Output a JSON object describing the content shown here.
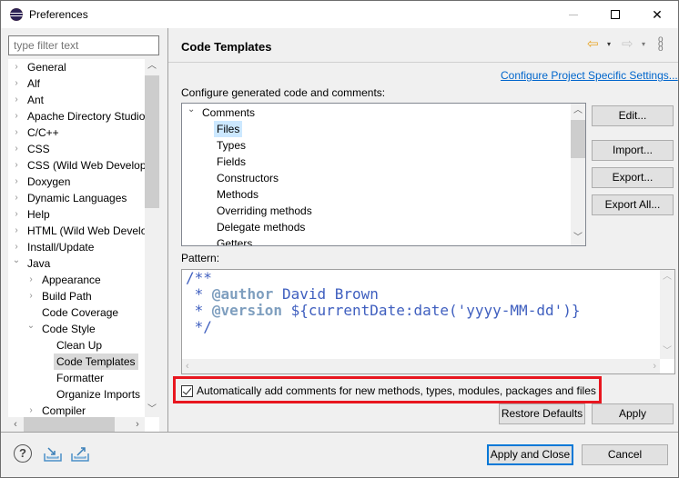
{
  "window": {
    "title": "Preferences",
    "controls": {
      "minimize": "—",
      "maximize": "□",
      "close": "✕"
    }
  },
  "sidebar": {
    "filter_placeholder": "type filter text",
    "items": [
      {
        "label": "General",
        "level": 0,
        "expander": "collapsed"
      },
      {
        "label": "Alf",
        "level": 0,
        "expander": "collapsed"
      },
      {
        "label": "Ant",
        "level": 0,
        "expander": "collapsed"
      },
      {
        "label": "Apache Directory Studio",
        "level": 0,
        "expander": "collapsed"
      },
      {
        "label": "C/C++",
        "level": 0,
        "expander": "collapsed"
      },
      {
        "label": "CSS",
        "level": 0,
        "expander": "collapsed"
      },
      {
        "label": "CSS (Wild Web Developer)",
        "level": 0,
        "expander": "collapsed"
      },
      {
        "label": "Doxygen",
        "level": 0,
        "expander": "collapsed"
      },
      {
        "label": "Dynamic Languages",
        "level": 0,
        "expander": "collapsed"
      },
      {
        "label": "Help",
        "level": 0,
        "expander": "collapsed"
      },
      {
        "label": "HTML (Wild Web Developer)",
        "level": 0,
        "expander": "collapsed"
      },
      {
        "label": "Install/Update",
        "level": 0,
        "expander": "collapsed"
      },
      {
        "label": "Java",
        "level": 0,
        "expander": "expanded"
      },
      {
        "label": "Appearance",
        "level": 1,
        "expander": "collapsed"
      },
      {
        "label": "Build Path",
        "level": 1,
        "expander": "collapsed"
      },
      {
        "label": "Code Coverage",
        "level": 1,
        "expander": "none"
      },
      {
        "label": "Code Style",
        "level": 1,
        "expander": "expanded"
      },
      {
        "label": "Clean Up",
        "level": 2,
        "expander": "none"
      },
      {
        "label": "Code Templates",
        "level": 2,
        "expander": "none",
        "selected": true
      },
      {
        "label": "Formatter",
        "level": 2,
        "expander": "none"
      },
      {
        "label": "Organize Imports",
        "level": 2,
        "expander": "none"
      },
      {
        "label": "Compiler",
        "level": 1,
        "expander": "collapsed"
      }
    ]
  },
  "page": {
    "title": "Code Templates",
    "nav": {
      "back": "⇦",
      "forward": "⇨",
      "dropdown": "▾",
      "menu": "⋮"
    },
    "project_settings_link": "Configure Project Specific Settings...",
    "configure_label": "Configure generated code and comments:",
    "templates": {
      "group": "Comments",
      "items": [
        {
          "label": "Files",
          "selected": true
        },
        {
          "label": "Types"
        },
        {
          "label": "Fields"
        },
        {
          "label": "Constructors"
        },
        {
          "label": "Methods"
        },
        {
          "label": "Overriding methods"
        },
        {
          "label": "Delegate methods"
        },
        {
          "label": "Getters"
        }
      ]
    },
    "buttons": {
      "edit": "Edit...",
      "import": "Import...",
      "export": "Export...",
      "export_all": "Export All..."
    },
    "pattern_label": "Pattern:",
    "pattern": {
      "line1": "/**",
      "line2_prefix": " * ",
      "line2_tag": "@author",
      "line2_value": " David Brown",
      "line3_prefix": " * ",
      "line3_tag": "@version",
      "line3_value": " ${currentDate:date('yyyy-MM-dd')}",
      "line4": " */"
    },
    "auto_comments": {
      "checked": true,
      "label": "Automatically add comments for new methods, types, modules, packages and files"
    },
    "restore_defaults": "Restore Defaults",
    "apply": "Apply"
  },
  "footer": {
    "apply_and_close": "Apply and Close",
    "cancel": "Cancel",
    "help_icon": "?"
  },
  "colors": {
    "highlight_border": "#e8161f",
    "link": "#0066cc",
    "selection": "#cce8ff",
    "default_button_border": "#0078d7"
  }
}
